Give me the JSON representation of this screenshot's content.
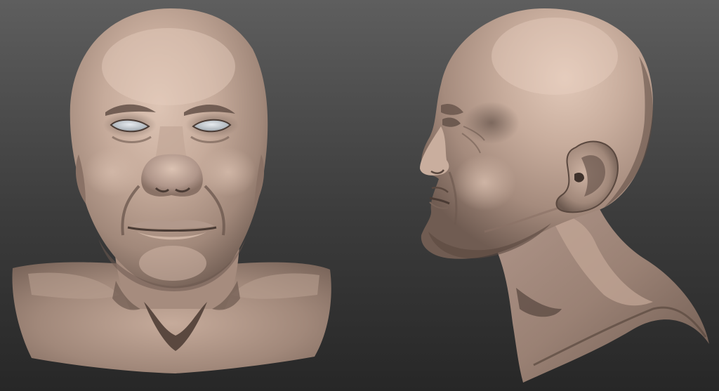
{
  "scene": {
    "background_colors": {
      "top": "#5e5e5e",
      "middle": "#3c3c3c",
      "bottom": "#272727"
    },
    "material": {
      "skin_base": "#a1887a",
      "skin_light": "#c6ab9b",
      "skin_highlight": "#ddc4b4",
      "skin_shadow": "#6d5a50",
      "skin_deep_shadow": "#4a3b34",
      "eye_color": "#c8cdd2"
    },
    "views": [
      {
        "name": "front-view"
      },
      {
        "name": "side-view"
      }
    ]
  }
}
